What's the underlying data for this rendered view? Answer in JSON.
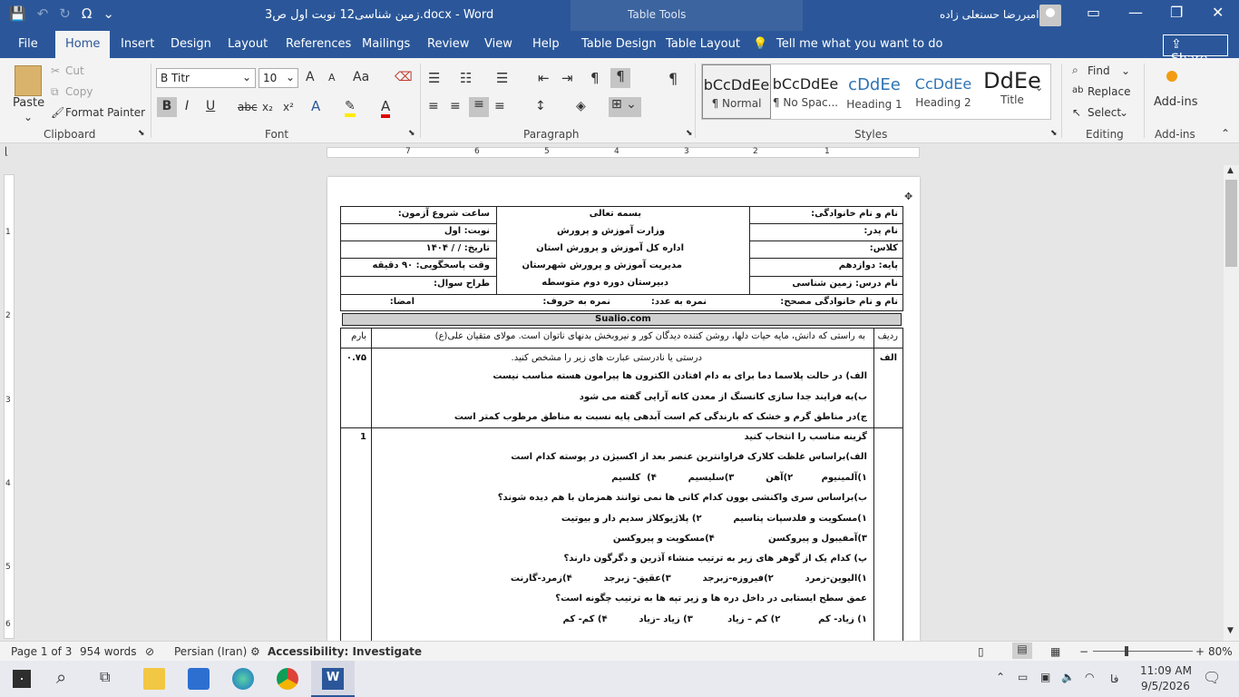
{
  "titlebar": {
    "document_title": "زمین شناسی12 نوبت اول ص3.docx  -  Word",
    "context_title": "Table Tools",
    "user_name": "امیررضا حسنعلی زاده",
    "qat_save": "💾",
    "qat_undo": "↶",
    "qat_redo": "↻",
    "qat_symbol": "Ω",
    "qat_more": "⌄",
    "ribbon_display": "▭",
    "minimize": "—",
    "maximize": "❐",
    "close": "✕"
  },
  "tabs": [
    "File",
    "Home",
    "Insert",
    "Design",
    "Layout",
    "References",
    "Mailings",
    "Review",
    "View",
    "Help",
    "Table Design",
    "Table Layout"
  ],
  "tell_me": "Tell me what you want to do",
  "share_label": "Share",
  "clipboard": {
    "paste": "Paste",
    "cut": "Cut",
    "copy": "Copy",
    "format_painter": "Format Painter",
    "group": "Clipboard"
  },
  "font": {
    "name": "B Titr",
    "size": "10",
    "group": "Font",
    "bold": "B",
    "italic": "I",
    "underline": "U",
    "strike": "abc",
    "subscript": "x₂",
    "superscript": "x²",
    "grow": "A",
    "shrink": "A",
    "case": "Aa",
    "text_effects": "A",
    "highlight": "✎",
    "font_color": "A"
  },
  "paragraph": {
    "group": "Paragraph",
    "pilcrow": "¶"
  },
  "styles": {
    "group": "Styles",
    "items": [
      {
        "preview": "bCcDdEe",
        "name": "¶ Normal"
      },
      {
        "preview": "bCcDdEe",
        "name": "¶ No Spac..."
      },
      {
        "preview": "cDdEe",
        "name": "Heading 1"
      },
      {
        "preview": "CcDdEe",
        "name": "Heading 2"
      },
      {
        "preview": "DdEe",
        "name": "Title"
      }
    ]
  },
  "editing": {
    "find": "Find",
    "replace": "Replace",
    "select": "Select",
    "group": "Editing"
  },
  "addins": {
    "label": "Add-ins",
    "group": "Add-ins"
  },
  "ruler": {
    "h_numbers": [
      "7",
      "6",
      "5",
      "4",
      "3",
      "2",
      "1"
    ],
    "v_numbers": [
      "1",
      "2",
      "3",
      "4",
      "5",
      "6"
    ]
  },
  "document": {
    "header_left": [
      "نام و نام خانوادگی:",
      "نام پدر:",
      "کلاس:",
      "پایه: دوازدهم",
      "نام درس: زمین شناسی"
    ],
    "header_center": [
      "بسمه تعالی",
      "وزارت آموزش و پرورش",
      "اداره کل آموزش و پرورش استان",
      "مدیریت آموزش و پرورش شهرستان",
      "دبیرستان دوره دوم متوسطه"
    ],
    "header_right": [
      "ساعت شروع آزمون:",
      "نوبت: اول",
      "تاریخ:   /   /   ۱۴۰۴",
      "وقت پاسخگویی: ۹۰ دقیقه",
      "طراح سوال:"
    ],
    "grader_row": {
      "name": "نام و نام خانوادگی مصحح:",
      "score_num": "نمره به عدد:",
      "score_text": "نمره به حروف:",
      "sign": "امضا:"
    },
    "site": "Sualio.com",
    "col_row": "ردیف",
    "col_score": "بارم",
    "quote": "به راستی که دانش، مایه حیات دلها، روشن کننده دیدگان کور و نیروبخش بدنهای ناتوان است. مولای متقیان علی(ع)",
    "q1": {
      "num": "الف",
      "score": "۰.۷۵",
      "lines": [
        "درستی یا نادرستی عبارت های زیر را مشخص کنید.",
        "الف) در حالت پلاسما دما برای به دام افتادن الکترون ها پیرامون هسته مناسب نیست",
        "ب)به فرایند جدا سازی کانسنگ از معدن کانه آرایی گفته می شود",
        "ج)در مناطق گرم و خشک که بارندگی کم است آبدهی پایه نسبت به مناطق مرطوب کمتر است"
      ]
    },
    "q2": {
      "score": "1",
      "lines": [
        "گزینه مناسب را انتخاب کنید",
        "الف)براساس غلظت کلارک فراوانترین عنصر بعد از اکسیژن در پوسته کدام است",
        "۱)آلمینیوم         ۲)آهن          ۳)سلیسیم          ۴)  کلسیم",
        "ب)براساس سری واکنشی بوون کدام کانی ها نمی توانند همزمان با هم دیده شوند؟",
        "۱)مسکویت و فلدسپات پتاسیم          ۲) پلاژیوکلاز سدیم دار و بیوتیت",
        "۳)آمفیبول و پیروکسن                 ۴)مسکویت و پیروکسن",
        "پ)  کدام یک از گوهر های زیر به ترتیب منشاء آذرین و دگرگون دارند؟",
        "۱)الیوین-زمرد          ۲)فیروزه-زبرجد          ۳)عقیق- زبرجد          ۴)زمرد-گارنت",
        "عمق سطح ایستابی در داخل دره ها و زیر تپه ها به ترتیب چگونه است؟",
        "۱) زیاد- کم            ۲) کم – زیاد           ۳) زیاد –زیاد          ۴) کم- کم"
      ]
    }
  },
  "statusbar": {
    "page": "Page 1 of 3",
    "words": "954 words",
    "language": "Persian (Iran)",
    "accessibility": "Accessibility: Investigate",
    "zoom": "80%"
  },
  "taskbar": {
    "time": "11:09 AM",
    "date": "9/5/2026",
    "lang": "فا"
  }
}
